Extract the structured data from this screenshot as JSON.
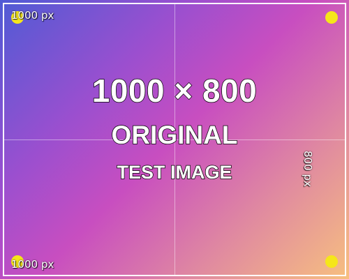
{
  "colors": {
    "gradient_start": "#4f5bd5",
    "gradient_mid": "#c84ec0",
    "gradient_end": "#f7c07f",
    "corner_dot": "#f5e61a",
    "border": "#ffffff"
  },
  "labels": {
    "top_left": "1000 px",
    "bottom_left": "1000 px",
    "right_vertical": "800 px"
  },
  "main": {
    "dimensions": "1000 × 800",
    "status": "ORIGINAL",
    "subtitle": "TEST IMAGE"
  }
}
